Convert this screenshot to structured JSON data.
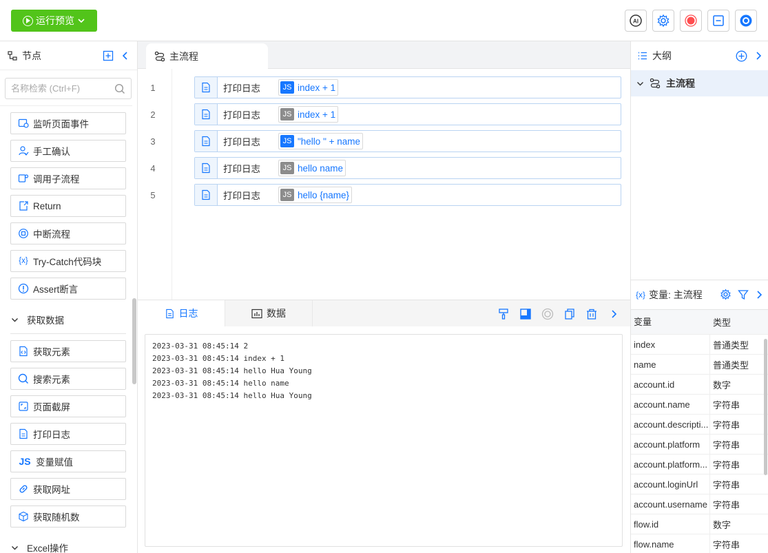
{
  "toolbar": {
    "run_label": "运行预览",
    "icons": [
      "ai-icon",
      "settings-icon",
      "record-icon",
      "minimize-icon",
      "circle-app-icon"
    ],
    "ai_label": "AI"
  },
  "left_panel": {
    "title": "节点",
    "search_placeholder": "名称检索 (Ctrl+F)",
    "nodes": [
      {
        "label": "监听页面事件",
        "icon": "page-listen-icon"
      },
      {
        "label": "手工确认",
        "icon": "user-confirm-icon"
      },
      {
        "label": "调用子流程",
        "icon": "subflow-icon"
      },
      {
        "label": "Return",
        "icon": "return-icon"
      },
      {
        "label": "中断流程",
        "icon": "stop-icon"
      },
      {
        "label": "Try-Catch代码块",
        "icon": "try-catch-icon",
        "glyph": "{x}"
      },
      {
        "label": "Assert断言",
        "icon": "assert-icon"
      }
    ],
    "group_fetch": "获取数据",
    "fetch_nodes": [
      {
        "label": "获取元素",
        "icon": "code-element-icon"
      },
      {
        "label": "搜索元素",
        "icon": "search-element-icon"
      },
      {
        "label": "页面截屏",
        "icon": "screenshot-icon"
      },
      {
        "label": "打印日志",
        "icon": "log-icon"
      },
      {
        "label": "变量赋值",
        "icon": "js-icon",
        "glyph": "JS"
      },
      {
        "label": "获取网址",
        "icon": "link-icon"
      },
      {
        "label": "获取随机数",
        "icon": "cube-icon"
      }
    ],
    "group_excel": "Excel操作"
  },
  "editor": {
    "tab_label": "主流程",
    "steps": [
      {
        "line": "1",
        "label": "打印日志",
        "expr": "index + 1",
        "js_active": true,
        "js": "JS"
      },
      {
        "line": "2",
        "label": "打印日志",
        "expr": "index + 1",
        "js_active": false,
        "js": "JS"
      },
      {
        "line": "3",
        "label": "打印日志",
        "expr": "\"hello \" + name",
        "js_active": true,
        "js": "JS"
      },
      {
        "line": "4",
        "label": "打印日志",
        "expr": "hello name",
        "js_active": false,
        "js": "JS"
      },
      {
        "line": "5",
        "label": "打印日志",
        "expr": "hello {name}",
        "js_active": false,
        "js": "JS"
      }
    ]
  },
  "bottom_panel": {
    "tab_log": "日志",
    "tab_data": "数据",
    "logs": [
      "2023-03-31 08:45:14 2",
      "2023-03-31 08:45:14 index + 1",
      "2023-03-31 08:45:14 hello Hua Young",
      "2023-03-31 08:45:14 hello name",
      "2023-03-31 08:45:14 hello Hua Young"
    ]
  },
  "right_panel": {
    "outline_title": "大纲",
    "outline_item": "主流程",
    "vars_glyph": "{x}",
    "vars_title": "变量: 主流程",
    "col_name": "变量",
    "col_type": "类型",
    "vars": [
      {
        "name": "index",
        "type": "普通类型"
      },
      {
        "name": "name",
        "type": "普通类型"
      },
      {
        "name": "account.id",
        "type": "数字"
      },
      {
        "name": "account.name",
        "type": "字符串"
      },
      {
        "name": "account.descripti...",
        "type": "字符串"
      },
      {
        "name": "account.platform",
        "type": "字符串"
      },
      {
        "name": "account.platform...",
        "type": "字符串"
      },
      {
        "name": "account.loginUrl",
        "type": "字符串"
      },
      {
        "name": "account.username",
        "type": "字符串"
      },
      {
        "name": "flow.id",
        "type": "数字"
      },
      {
        "name": "flow.name",
        "type": "字符串"
      }
    ]
  },
  "colors": {
    "accent": "#1677ff",
    "run_green": "#52c41a",
    "record_red": "#ff4d4f",
    "js_gray": "#8c8c8c"
  }
}
